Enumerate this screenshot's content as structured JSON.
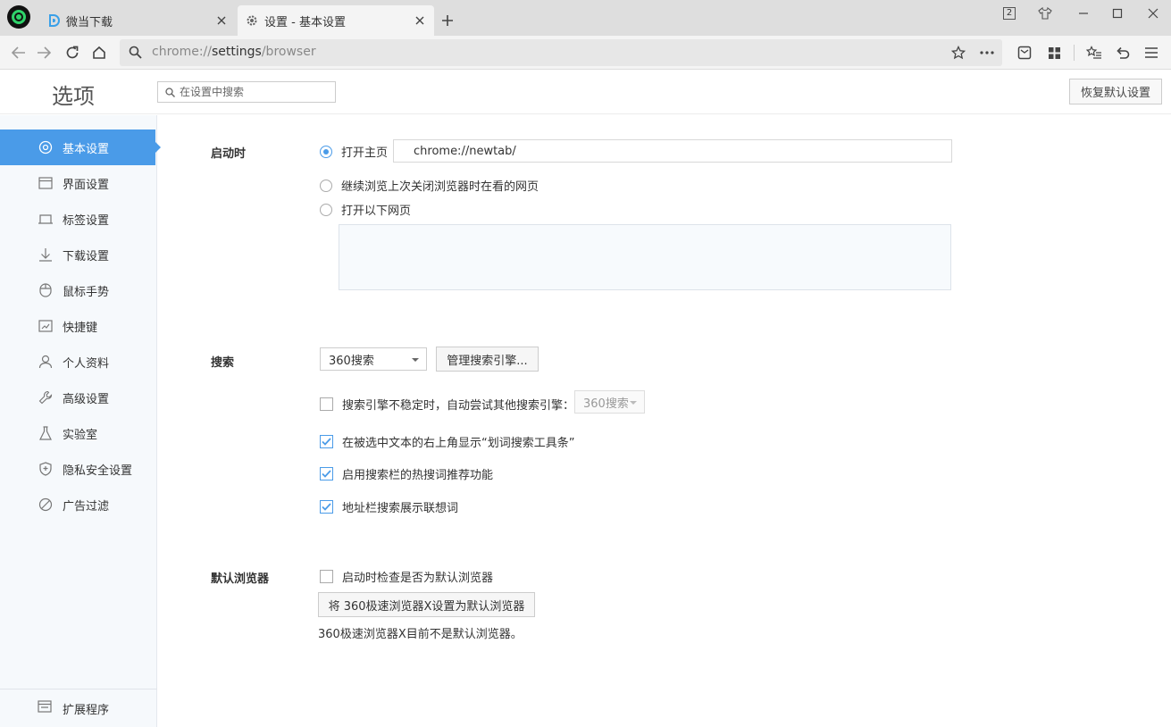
{
  "tabs": [
    {
      "label": "微当下载",
      "icon": "weidown-logo-icon"
    },
    {
      "label": "设置 - 基本设置",
      "icon": "gear-icon"
    }
  ],
  "window": {
    "tab_count_badge": "2"
  },
  "toolbar": {
    "url_scheme": "chrome://",
    "url_host": "settings",
    "url_path": "/browser"
  },
  "header": {
    "title": "选项",
    "search_placeholder": "在设置中搜索",
    "restore_label": "恢复默认设置"
  },
  "sidebar": {
    "items": [
      {
        "label": "基本设置",
        "icon": "settings-circle-icon",
        "active": true
      },
      {
        "label": "界面设置",
        "icon": "window-icon"
      },
      {
        "label": "标签设置",
        "icon": "tab-icon"
      },
      {
        "label": "下载设置",
        "icon": "download-icon"
      },
      {
        "label": "鼠标手势",
        "icon": "mouse-icon"
      },
      {
        "label": "快捷键",
        "icon": "shortcut-icon"
      },
      {
        "label": "个人资料",
        "icon": "person-icon"
      },
      {
        "label": "高级设置",
        "icon": "wrench-icon"
      },
      {
        "label": "实验室",
        "icon": "flask-icon"
      },
      {
        "label": "隐私安全设置",
        "icon": "shield-icon"
      },
      {
        "label": "广告过滤",
        "icon": "block-icon"
      }
    ],
    "extensions_label": "扩展程序"
  },
  "startup": {
    "label": "启动时",
    "options": [
      {
        "label": "打开主页",
        "checked": true
      },
      {
        "label": "继续浏览上次关闭浏览器时在看的网页",
        "checked": false
      },
      {
        "label": "打开以下网页",
        "checked": false
      }
    ],
    "homepage_value": "chrome://newtab/"
  },
  "search": {
    "label": "搜索",
    "engine_selected": "360搜索",
    "manage_label": "管理搜索引擎...",
    "fallback_label": "搜索引擎不稳定时，自动尝试其他搜索引擎：",
    "fallback_checked": false,
    "fallback_engine": "360搜索",
    "options": [
      {
        "label": "在被选中文本的右上角显示“划词搜索工具条”",
        "checked": true
      },
      {
        "label": "启用搜索栏的热搜词推荐功能",
        "checked": true
      },
      {
        "label": "地址栏搜索展示联想词",
        "checked": true
      }
    ]
  },
  "default_browser": {
    "label": "默认浏览器",
    "check_label": "启动时检查是否为默认浏览器",
    "check_checked": false,
    "set_button": "将 360极速浏览器X设置为默认浏览器",
    "status": "360极速浏览器X目前不是默认浏览器。"
  },
  "colors": {
    "accent": "#4a9be8",
    "sidebar_bg": "#f6f9fc"
  }
}
